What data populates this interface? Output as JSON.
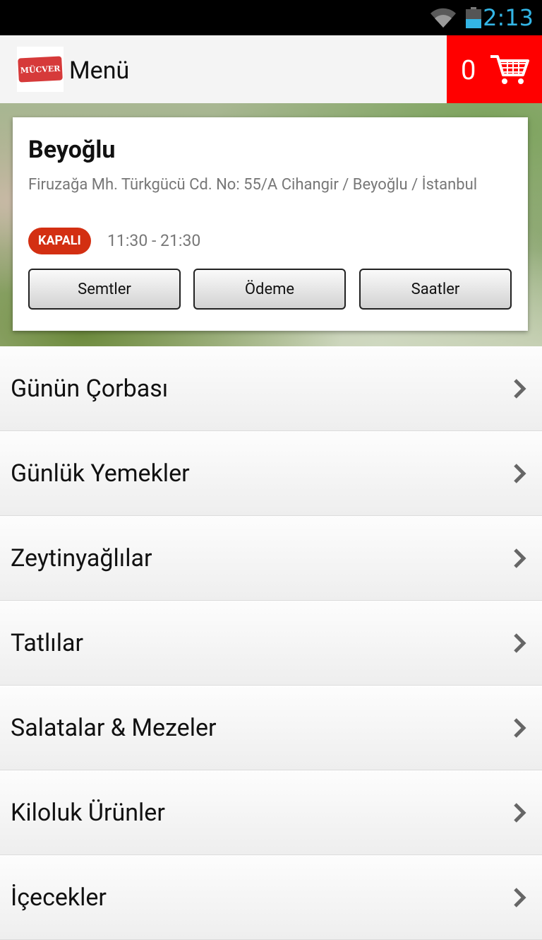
{
  "status_bar": {
    "time": "2:13"
  },
  "header": {
    "logo_text": "MÜCVER",
    "title": "Menü",
    "cart_count": "0",
    "accent": "#ff0000"
  },
  "store": {
    "name": "Beyoğlu",
    "address": "Firuzağa Mh. Türkgücü Cd. No: 55/A Cihangir / Beyoğlu / İstanbul",
    "status": "KAPALI",
    "hours": "11:30 - 21:30",
    "buttons": [
      {
        "label": "Semtler"
      },
      {
        "label": "Ödeme"
      },
      {
        "label": "Saatler"
      }
    ]
  },
  "menu": {
    "items": [
      {
        "label": "Günün Çorbası"
      },
      {
        "label": "Günlük Yemekler"
      },
      {
        "label": "Zeytinyağlılar"
      },
      {
        "label": "Tatlılar"
      },
      {
        "label": "Salatalar & Mezeler"
      },
      {
        "label": "Kiloluk Ürünler"
      },
      {
        "label": "İçecekler"
      }
    ]
  }
}
